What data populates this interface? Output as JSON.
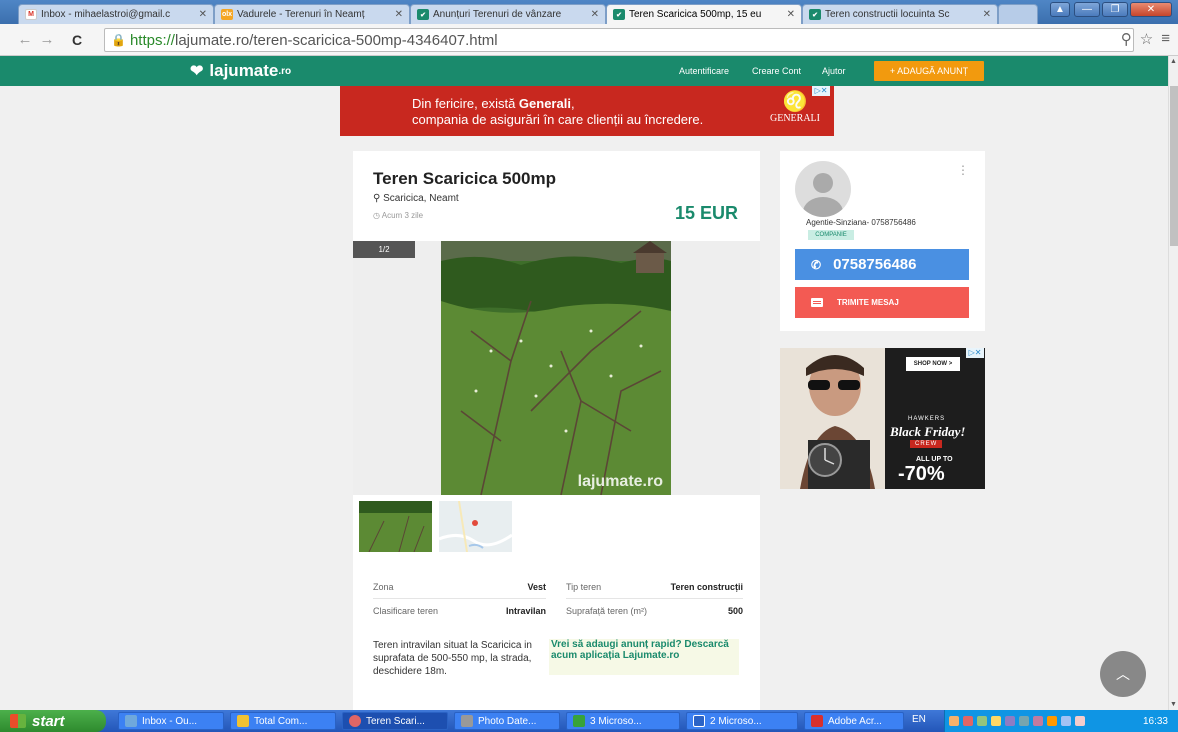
{
  "browser": {
    "tabs": [
      {
        "title": "Inbox - mihaelastroi@gmail.c",
        "favicon": "gmail-icon",
        "active": false
      },
      {
        "title": "Vadurele - Terenuri în Neamț",
        "favicon": "olx-icon",
        "active": false
      },
      {
        "title": "Anunțuri Terenuri de vânzare",
        "favicon": "lajumate-icon",
        "active": false
      },
      {
        "title": "Teren Scaricica 500mp, 15 eu",
        "favicon": "lajumate-icon",
        "active": true
      },
      {
        "title": "Teren constructii locuinta Sc",
        "favicon": "lajumate-icon",
        "active": false
      }
    ],
    "url_scheme": "https://",
    "url_rest": "lajumate.ro/teren-scaricica-500mp-4346407.html"
  },
  "site": {
    "logo_text": "lajumate",
    "logo_suffix": ".ro",
    "nav": {
      "login": "Autentificare",
      "register": "Creare Cont",
      "help": "Ajutor"
    },
    "add_ad": "+ ADAUGĂ ANUNȚ",
    "accent": "#1a8a6c"
  },
  "top_ad": {
    "line1_prefix": "Din fericire, există ",
    "line1_brand": "Generali",
    "line1_suffix": ",",
    "line2": "compania de asigurări în care clienții au încredere.",
    "logo_text": "GENERALI",
    "bg": "#c8281f"
  },
  "listing": {
    "title": "Teren Scaricica 500mp",
    "location": "Scaricica, Neamt",
    "posted": "Acum 3 zile",
    "price": "15 EUR",
    "photo_counter": "1/2",
    "watermark": "lajumate.ro",
    "details": [
      {
        "label": "Zona",
        "value": "Vest"
      },
      {
        "label": "Tip teren",
        "value": "Teren construcții"
      },
      {
        "label": "Clasificare teren",
        "value": "Intravilan"
      },
      {
        "label": "Suprafață teren (m²)",
        "value": "500"
      }
    ],
    "description": "Teren intravilan situat la Scaricica in suprafata de 500-550 mp, la strada, deschidere 18m.",
    "promo": "Vrei să adaugi anunț rapid? Descarcă acum aplicația Lajumate.ro"
  },
  "seller": {
    "name": "Agentie-Sinziana- 0758756486",
    "badge": "COMPANIE",
    "phone": "0758756486",
    "message_button": "TRIMITE MESAJ"
  },
  "side_ad": {
    "shop_now": "SHOP NOW >",
    "brand": "HAWKERS",
    "headline": "Black Friday!",
    "tag": "CREW",
    "subline": "ALL UP TO",
    "discount": "-70%"
  },
  "taskbar": {
    "start": "start",
    "tasks": [
      {
        "label": "Inbox - Ou...",
        "icon": "outlook-icon"
      },
      {
        "label": "Total Com...",
        "icon": "total-commander-icon"
      },
      {
        "label": "Teren Scari...",
        "icon": "chrome-icon",
        "active": true
      },
      {
        "label": "Photo Date...",
        "icon": "photo-icon"
      },
      {
        "label": "3 Microso...",
        "icon": "excel-icon"
      },
      {
        "label": "2 Microso...",
        "icon": "word-icon"
      },
      {
        "label": "Adobe Acr...",
        "icon": "acrobat-icon"
      }
    ],
    "language": "EN",
    "clock": "16:33"
  }
}
